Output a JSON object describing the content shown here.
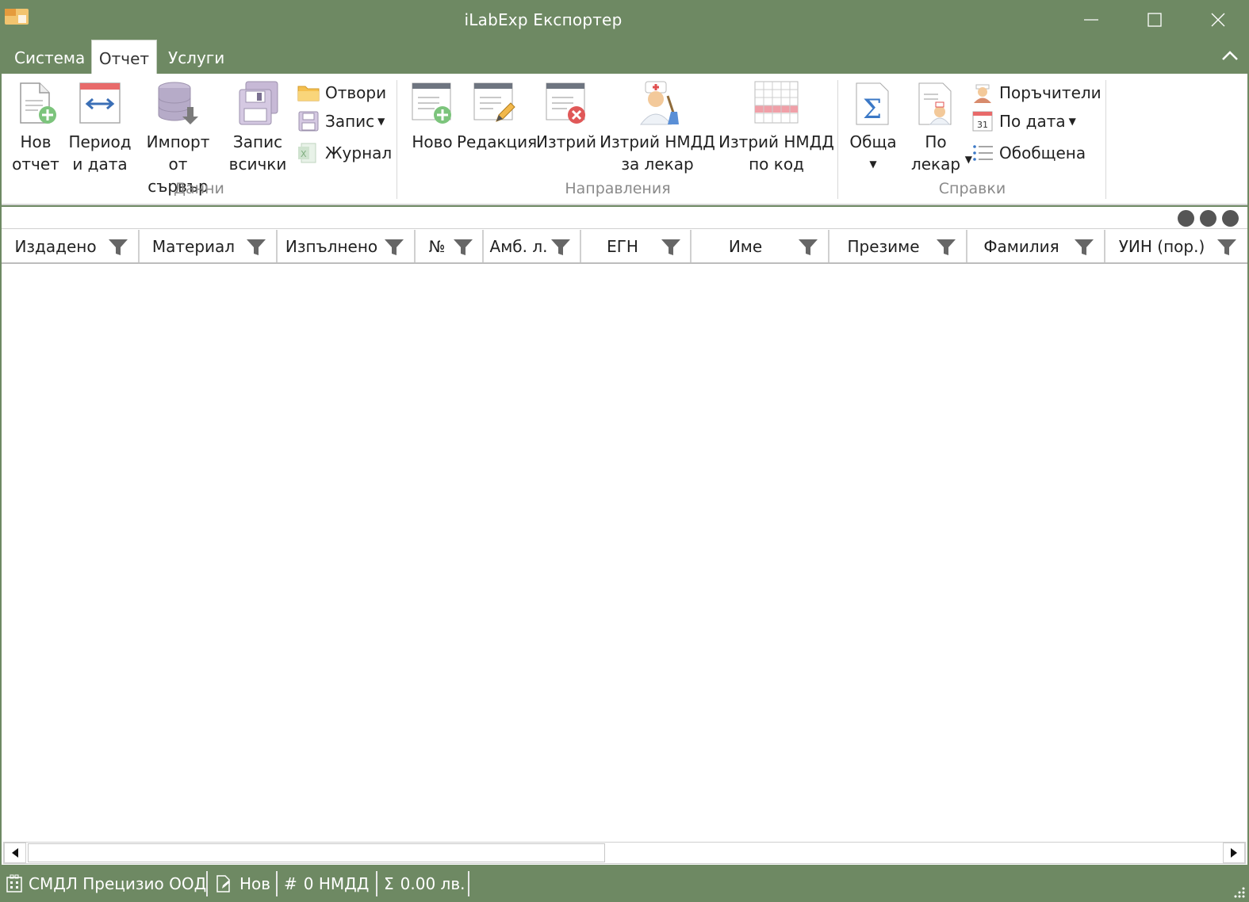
{
  "window": {
    "title": "iLabExp Експортер"
  },
  "tabs": [
    {
      "label": "Система"
    },
    {
      "label": "Отчет"
    },
    {
      "label": "Услуги"
    }
  ],
  "ribbon": {
    "data_group": {
      "label": "Данни",
      "new_report": "Нов\nотчет",
      "period_date": "Период\nи дата",
      "import_server": "Импорт от\nсървър",
      "save_all": "Запис\nвсички",
      "open": "Отвори",
      "save": "Запис",
      "journal": "Журнал"
    },
    "referrals_group": {
      "label": "Направления",
      "new": "Ново",
      "edit": "Редакция",
      "delete": "Изтрий",
      "delete_by_doctor": "Изтрий НМДД\nза лекар",
      "delete_by_code": "Изтрий НМДД\nпо код"
    },
    "reports_group": {
      "label": "Справки",
      "general": "Обща",
      "by_doctor": "По\nлекар",
      "orderers": "Поръчители",
      "by_date": "По дата",
      "summary": "Обобщена"
    }
  },
  "grid": {
    "columns": [
      {
        "label": "Издадено"
      },
      {
        "label": "Материал"
      },
      {
        "label": "Изпълнено"
      },
      {
        "label": "№"
      },
      {
        "label": "Амб. л."
      },
      {
        "label": "ЕГН"
      },
      {
        "label": "Име"
      },
      {
        "label": "Презиме"
      },
      {
        "label": "Фамилия"
      },
      {
        "label": "УИН (пор.)"
      }
    ]
  },
  "status": {
    "company": "СМДЛ Прецизио ООД",
    "state": "Нов",
    "count": "0 НМДД",
    "total": "0.00 лв."
  },
  "colors": {
    "accent": "#6e8963"
  }
}
